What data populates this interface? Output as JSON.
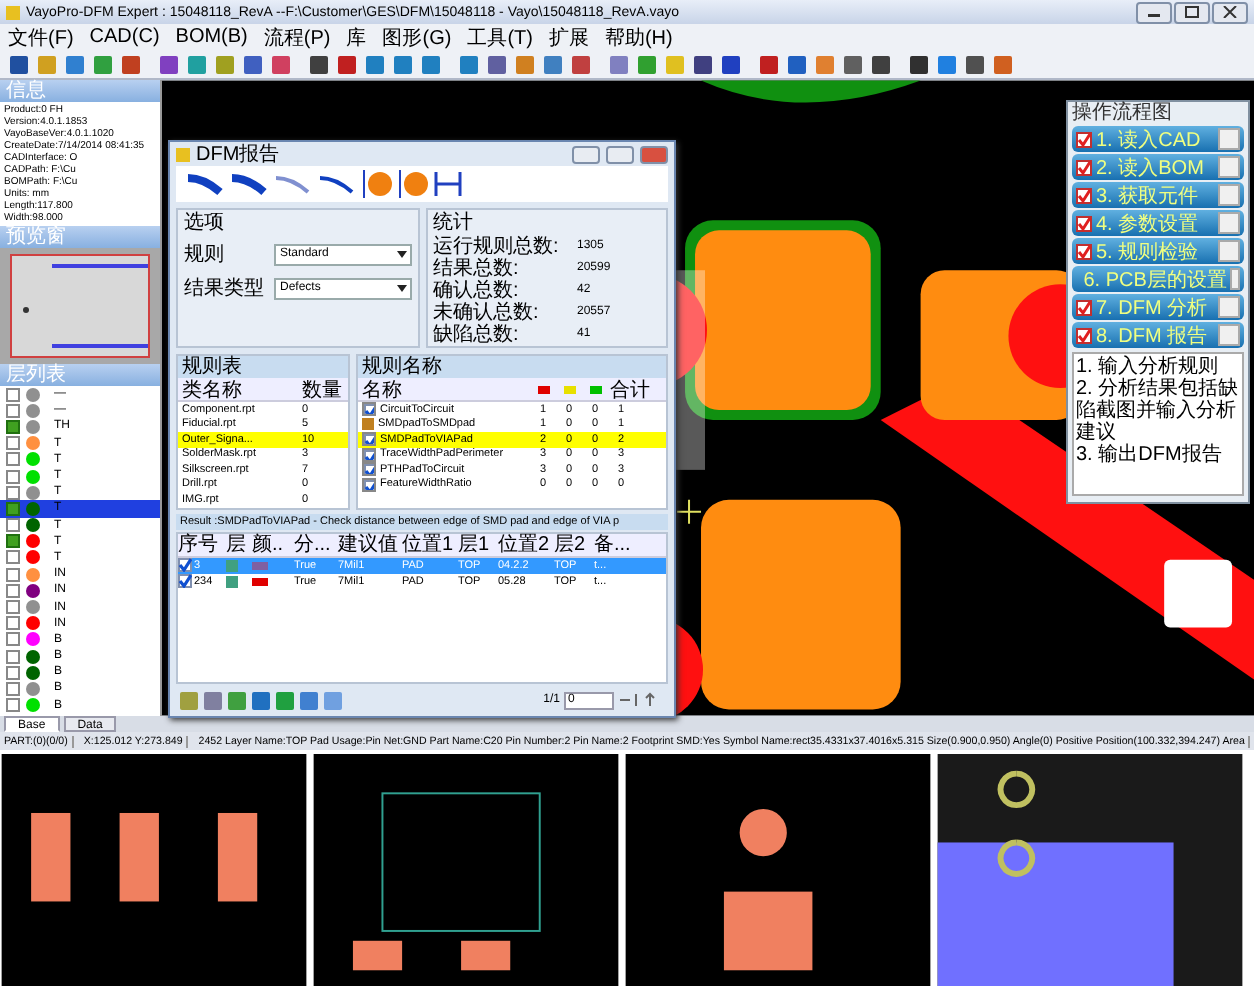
{
  "window": {
    "title": "VayoPro-DFM Expert : 15048118_RevA  --F:\\Customer\\GES\\DFM\\15048118 - Vayo\\15048118_RevA.vayo"
  },
  "menu": [
    "文件(F)",
    "CAD(C)",
    "BOM(B)",
    "流程(P)",
    "库",
    "图形(G)",
    "工具(T)",
    "扩展",
    "帮助(H)"
  ],
  "info_panel": {
    "title": "信息",
    "lines": [
      "Product:0 FH",
      "Version:4.0.1.1853",
      "VayoBaseVer:4.0.1.1020",
      "CreateDate:7/14/2014 08:41:35",
      "CADInterface: O",
      "CADPath: F:\\Cu",
      "BOMPath: F:\\Cu",
      "Units: mm",
      "Length:117.800",
      "Width:98.000"
    ]
  },
  "preview_panel": {
    "title": "预览窗"
  },
  "layer_panel": {
    "title": "层列表",
    "layers": [
      {
        "label": "—",
        "checked": false,
        "selected": false,
        "color": "#909090"
      },
      {
        "label": "—",
        "checked": false,
        "selected": false,
        "color": "#909090"
      },
      {
        "label": "TH",
        "checked": true,
        "selected": false,
        "color": "#909090"
      },
      {
        "label": "T",
        "checked": false,
        "selected": false,
        "color": "#ff9040"
      },
      {
        "label": "T",
        "checked": false,
        "selected": false,
        "color": "#00e000"
      },
      {
        "label": "T",
        "checked": false,
        "selected": false,
        "color": "#00e000"
      },
      {
        "label": "T",
        "checked": false,
        "selected": false,
        "color": "#909090"
      },
      {
        "label": "T",
        "checked": true,
        "selected": true,
        "color": "#006400"
      },
      {
        "label": "T",
        "checked": false,
        "selected": false,
        "color": "#006400"
      },
      {
        "label": "T",
        "checked": true,
        "selected": false,
        "color": "#ff0000"
      },
      {
        "label": "T",
        "checked": false,
        "selected": false,
        "color": "#ff0000"
      },
      {
        "label": "IN",
        "checked": false,
        "selected": false,
        "color": "#ff9040"
      },
      {
        "label": "IN",
        "checked": false,
        "selected": false,
        "color": "#800080"
      },
      {
        "label": "IN",
        "checked": false,
        "selected": false,
        "color": "#909090"
      },
      {
        "label": "IN",
        "checked": false,
        "selected": false,
        "color": "#ff0000"
      },
      {
        "label": "B",
        "checked": false,
        "selected": false,
        "color": "#ff00ff"
      },
      {
        "label": "B",
        "checked": false,
        "selected": false,
        "color": "#006400"
      },
      {
        "label": "B",
        "checked": false,
        "selected": false,
        "color": "#006400"
      },
      {
        "label": "B",
        "checked": false,
        "selected": false,
        "color": "#909090"
      },
      {
        "label": "B",
        "checked": false,
        "selected": false,
        "color": "#00e000"
      }
    ]
  },
  "panel_tabs": [
    {
      "label": "Base",
      "selected": true
    },
    {
      "label": "Data",
      "selected": false
    }
  ],
  "dfm_dialog": {
    "title": "DFM报告",
    "options": {
      "title": "选项",
      "fields": [
        {
          "label": "规则",
          "value": "Standard"
        },
        {
          "label": "结果类型",
          "value": "Defects"
        }
      ]
    },
    "stats": {
      "title": "统计",
      "rows": [
        {
          "label": "运行规则总数:",
          "value": "1305"
        },
        {
          "label": "结果总数:",
          "value": "20599"
        },
        {
          "label": "确认总数:",
          "value": "42"
        },
        {
          "label": "未确认总数:",
          "value": "20557"
        },
        {
          "label": "缺陷总数:",
          "value": "41"
        }
      ]
    },
    "rule_files": {
      "title": "规则表",
      "columns": [
        "类名称",
        "数量"
      ],
      "rows": [
        {
          "name": "Component.rpt",
          "count": "0",
          "selected": false
        },
        {
          "name": "Fiducial.rpt",
          "count": "5",
          "selected": false
        },
        {
          "name": "Outer_Signa...",
          "count": "10",
          "selected": true
        },
        {
          "name": "SolderMask.rpt",
          "count": "3",
          "selected": false
        },
        {
          "name": "Silkscreen.rpt",
          "count": "7",
          "selected": false
        },
        {
          "name": "Drill.rpt",
          "count": "0",
          "selected": false
        },
        {
          "name": "IMG.rpt",
          "count": "0",
          "selected": false
        }
      ]
    },
    "rules": {
      "title": "规则名称",
      "name_column": "名称",
      "total_column": "合计",
      "severity_columns": [
        {
          "color": "#e00000"
        },
        {
          "color": "#e8e000"
        },
        {
          "color": "#00c000"
        }
      ],
      "rows": [
        {
          "kind": "check",
          "checked": true,
          "name": "CircuitToCircuit",
          "counts": [
            "1",
            "0",
            "0"
          ],
          "total": "1",
          "selected": false
        },
        {
          "kind": "flag",
          "name": "SMDpadToSMDpad",
          "counts": [
            "1",
            "0",
            "0"
          ],
          "total": "1",
          "selected": false
        },
        {
          "kind": "check",
          "checked": true,
          "name": "SMDPadToVIAPad",
          "counts": [
            "2",
            "0",
            "0"
          ],
          "total": "2",
          "selected": true
        },
        {
          "kind": "check",
          "checked": true,
          "name": "TraceWidthPadPerimeter",
          "counts": [
            "3",
            "0",
            "0"
          ],
          "total": "3",
          "selected": false
        },
        {
          "kind": "check",
          "checked": true,
          "name": "PTHPadToCircuit",
          "counts": [
            "3",
            "0",
            "0"
          ],
          "total": "3",
          "selected": false
        },
        {
          "kind": "check",
          "checked": true,
          "name": "FeatureWidthRatio",
          "counts": [
            "0",
            "0",
            "0"
          ],
          "total": "0",
          "selected": false
        }
      ]
    },
    "result": "Result :SMDPadToVIAPad - Check distance between edge of SMD pad and edge of VIA p",
    "results_table": {
      "columns": [
        "序号",
        "层",
        "颜..",
        "分...",
        "建议值",
        "位置1",
        "层1",
        "位置2",
        "层2",
        "备..."
      ],
      "rows": [
        {
          "checked": true,
          "selected": true,
          "color": "#8060a0",
          "cells": [
            "3",
            "",
            "",
            "True",
            "7Mil1",
            "PAD",
            "TOP",
            "04.2.2",
            "TOP",
            "t..."
          ]
        },
        {
          "checked": true,
          "selected": false,
          "color": "#e00000",
          "cells": [
            "234",
            "",
            "",
            "True",
            "7Mil1",
            "PAD",
            "TOP",
            "05.28",
            "TOP",
            "t..."
          ]
        }
      ]
    },
    "pager": {
      "page": "1/1",
      "value": "0"
    }
  },
  "flow_panel": {
    "title": "操作流程图",
    "steps": [
      {
        "label": "1. 读入CAD",
        "checked": true
      },
      {
        "label": "2. 读入BOM",
        "checked": true
      },
      {
        "label": "3. 获取元件",
        "checked": true
      },
      {
        "label": "4. 参数设置",
        "checked": true
      },
      {
        "label": "5. 规则检验",
        "checked": true
      },
      {
        "label": "6. PCB层的设置",
        "checked": false
      },
      {
        "label": "7. DFM 分析",
        "checked": true
      },
      {
        "label": "8. DFM 报告",
        "checked": true
      }
    ],
    "notes": [
      "1. 输入分析规则",
      "2. 分析结果包括缺陷截图并输入分析建议",
      "3. 输出DFM报告"
    ]
  },
  "status_bar": [
    "PART:(0)(0/0)",
    "X:125.012 Y:273.849",
    "2452 Layer Name:TOP Pad Usage:Pin Net:GND Part Name:C20 Pin Number:2 Pin Name:2 Footprint SMD:Yes Symbol Name:rect35.4331x37.4016x5.315 Size(0.900,0.950) Angle(0) Positive Position(100.332,394.247) Area"
  ]
}
